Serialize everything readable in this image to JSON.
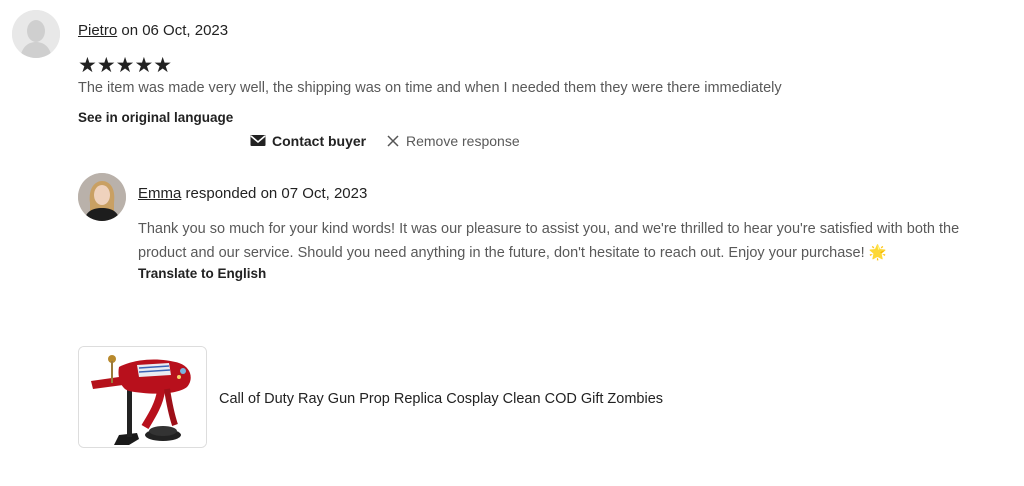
{
  "review": {
    "reviewer_name": "Pietro",
    "date_text": " on 06 Oct, 2023",
    "rating": "★★★★★",
    "text": "The item was made very well, the shipping was on time and when I needed them they were there immediately",
    "see_original_label": "See in original language"
  },
  "actions": {
    "contact_label": "Contact buyer",
    "remove_label": "Remove response"
  },
  "response": {
    "responder_name": "Emma",
    "date_text": " responded on 07 Oct, 2023",
    "text": "Thank you so much for your kind words! It was our pleasure to assist you, and we're thrilled to hear you're satisfied with both the product and our service. Should you need anything in the future, don't hesitate to reach out. Enjoy your purchase! 🌟",
    "translate_label": "Translate to English"
  },
  "product": {
    "title": "Call of Duty Ray Gun Prop Replica Cosplay Clean COD Gift Zombies"
  }
}
